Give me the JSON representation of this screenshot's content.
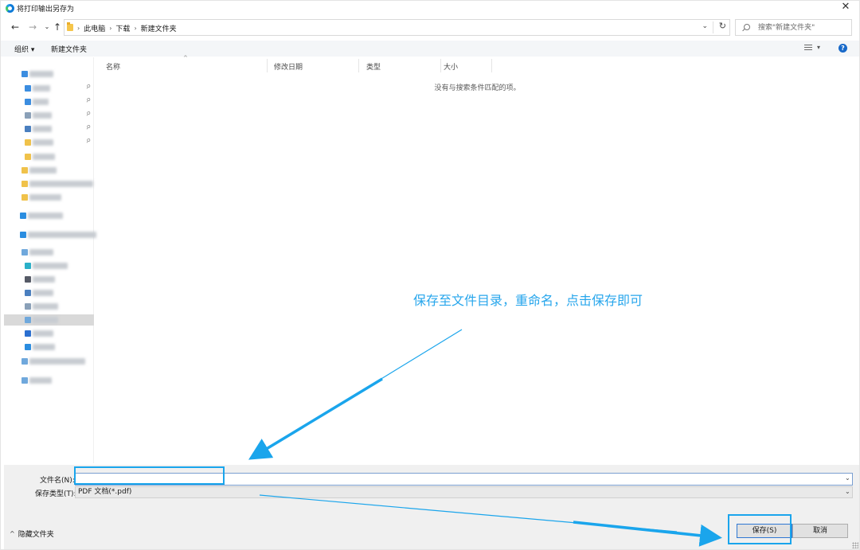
{
  "window": {
    "title": "将打印输出另存为",
    "close_glyph": "✕"
  },
  "nav": {
    "back_glyph": "←",
    "forward_glyph": "→",
    "recent_glyph": "⌄",
    "up_glyph": "↑",
    "breadcrumbs": [
      "此电脑",
      "下载",
      "新建文件夹"
    ],
    "crumb_sep": "›",
    "dropdown_glyph": "⌄",
    "refresh_glyph": "↻",
    "search_placeholder": "搜索\"新建文件夹\""
  },
  "toolbar": {
    "organize": "组织 ▾",
    "new_folder": "新建文件夹",
    "view_drop": "▾",
    "help": "?"
  },
  "filelist": {
    "columns": [
      "名称",
      "修改日期",
      "类型",
      "大小"
    ],
    "sort_caret": "^",
    "empty_message": "没有与搜索条件匹配的项。"
  },
  "sidebar": {
    "pin_glyph": "📌",
    "icon_colors": [
      "#3b8de0",
      "#3b8de0",
      "#3b8de0",
      "#8aa0b8",
      "#4a7fbf",
      "#f0c24a",
      "#f0c24a",
      "#f0c24a",
      "#f0c24a",
      "#f0c24a",
      "#2a8de0",
      "#2a8de0",
      "#6fa8dc",
      "#2ab0c8",
      "#555a66",
      "#4a7fbf",
      "#8aa0b8",
      "#6fa8dc",
      "#2a6fd0",
      "#2a8de0",
      "#6fa8dc",
      "#6fa8dc"
    ]
  },
  "bottom": {
    "filename_label": "文件名(N):",
    "filename_value": "",
    "filetype_label": "保存类型(T):",
    "filetype_value": "PDF 文档(*.pdf)",
    "dropdown_glyph": "⌄",
    "hide_folders": "隐藏文件夹",
    "hide_caret": "^",
    "save_button": "保存(S)",
    "cancel_button": "取消"
  },
  "annotation": {
    "text": "保存至文件目录，重命名，点击保存即可",
    "color": "#27a6ec"
  }
}
